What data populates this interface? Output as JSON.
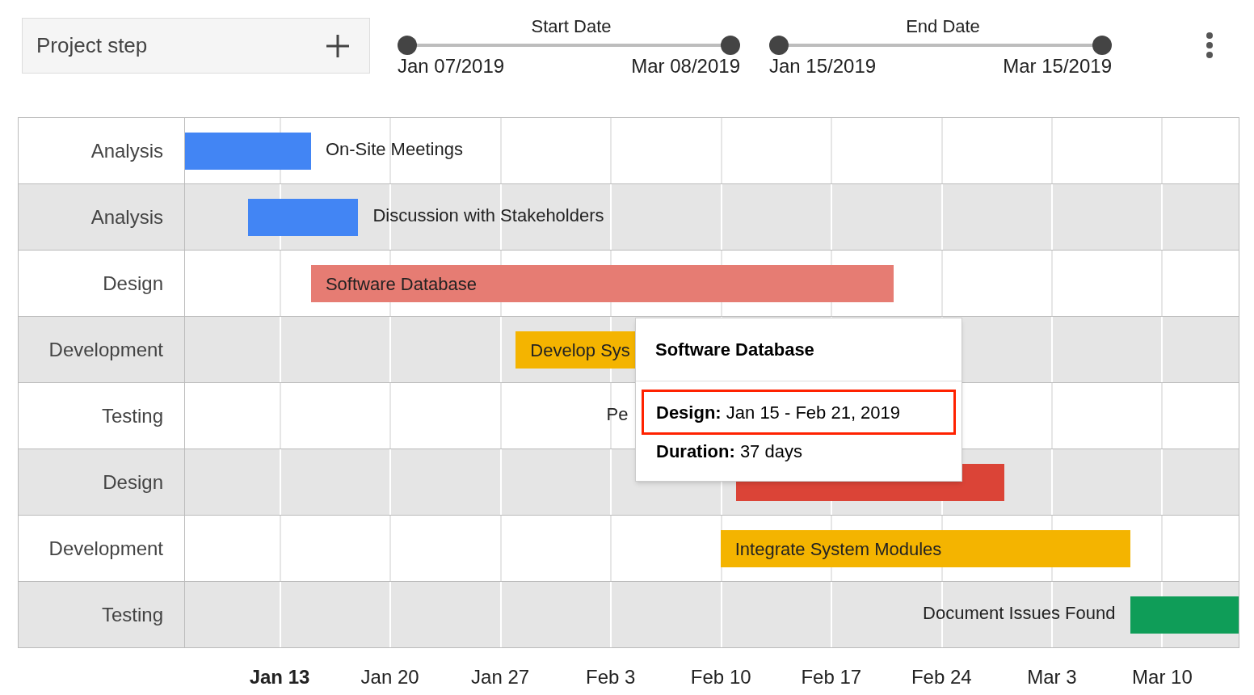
{
  "toolbar": {
    "field": {
      "placeholder": "Project step"
    },
    "sliders": [
      {
        "title": "Start Date",
        "min_label": "Jan 07/2019",
        "max_label": "Mar 08/2019",
        "thumbs": [
          {
            "level": 0
          },
          {
            "level": 1
          }
        ]
      },
      {
        "title": "End Date",
        "min_label": "Jan 15/2019",
        "max_label": "Mar 15/2019",
        "thumbs": [
          {
            "level": 0
          },
          {
            "level": 1
          }
        ]
      }
    ]
  },
  "gantt": {
    "tasks": [
      {
        "row_label": "Analysis",
        "label": "On-Site Meetings",
        "kind": "right",
        "color": "#4285f4"
      },
      {
        "row_label": "Analysis",
        "label": "Discussion with Stakeholders",
        "kind": "right",
        "color": "#4285f4"
      },
      {
        "row_label": "Design",
        "label": "Software Database",
        "kind": "inside",
        "color": "#e67c73"
      },
      {
        "row_label": "Development",
        "label": "Develop Sys",
        "kind": "inside",
        "color": "#f4b400"
      },
      {
        "row_label": "Testing",
        "label": "Pe",
        "kind": "text"
      },
      {
        "row_label": "Design",
        "kind": "inside",
        "color": "#db4437"
      },
      {
        "row_label": "Development",
        "label": "Integrate System Modules",
        "kind": "inside",
        "color": "#f4b400"
      },
      {
        "row_label": "Testing",
        "label": "Document Issues Found",
        "kind": "left",
        "color": "#0f9d58"
      }
    ],
    "axis": [
      {
        "label": "Jan 13",
        "bold": true
      },
      {
        "label": "Jan 20",
        "bold": false
      },
      {
        "label": "Jan 27",
        "bold": false
      },
      {
        "label": "Feb 3",
        "bold": false
      },
      {
        "label": "Feb 10",
        "bold": false
      },
      {
        "label": "Feb 17",
        "bold": false
      },
      {
        "label": "Feb 24",
        "bold": false
      },
      {
        "label": "Mar 3",
        "bold": false
      },
      {
        "label": "Mar 10",
        "bold": false
      }
    ],
    "tooltip": {
      "title": "Software Database",
      "lines": [
        {
          "text": "**Design:** Jan 15 - Feb 21, 2019",
          "highlighted": true
        },
        {
          "text": "**Duration:** 37 days",
          "highlighted": false
        }
      ]
    }
  }
}
